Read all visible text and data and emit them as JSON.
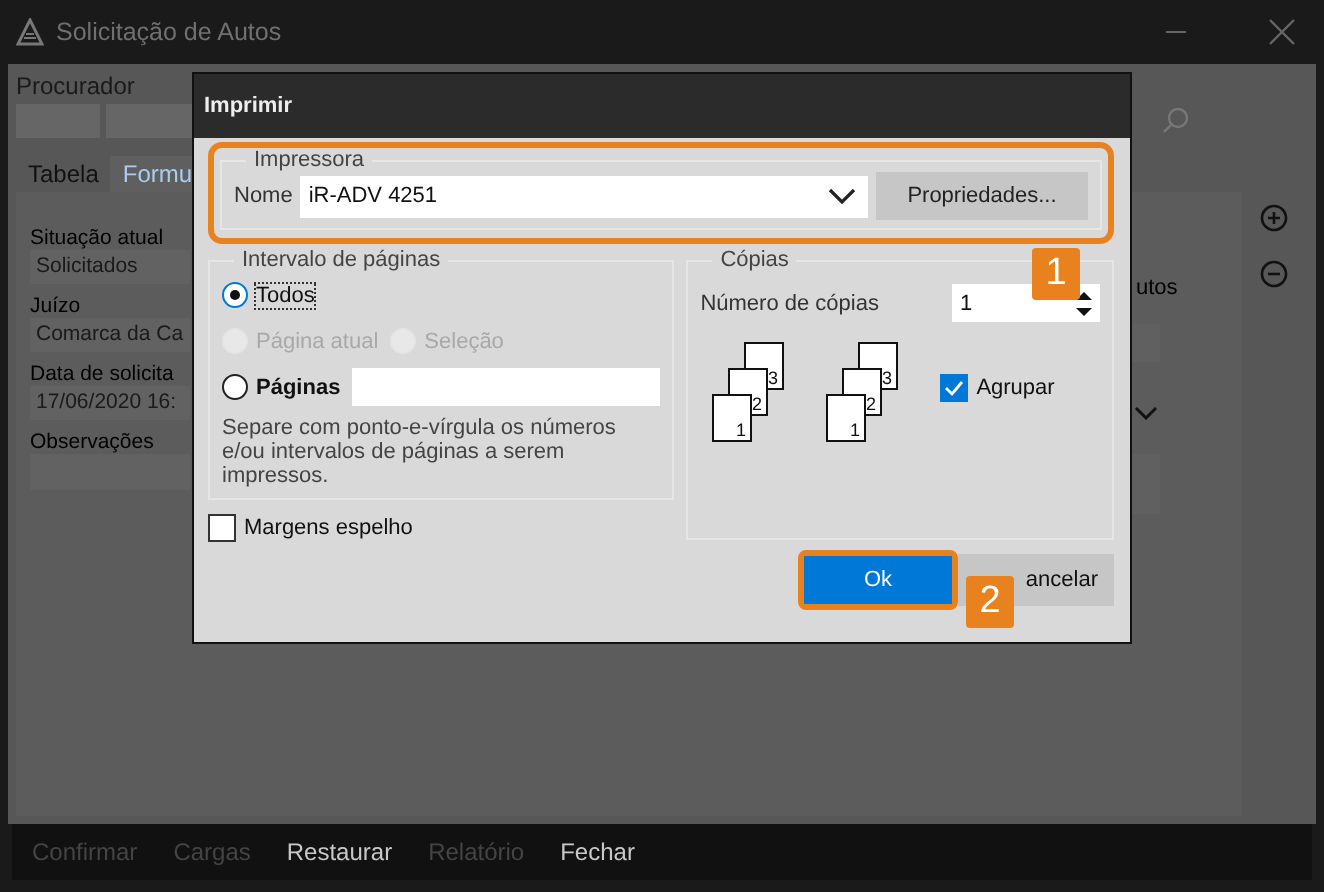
{
  "window": {
    "title": "Solicitação de Autos"
  },
  "background_form": {
    "procurador_label": "Procurador",
    "tabs": [
      {
        "label": "Tabela",
        "selected": false
      },
      {
        "label": "Formu",
        "selected": true
      }
    ],
    "fields": [
      {
        "label": "Situação atual",
        "value": "Solicitados"
      },
      {
        "label": "Juízo",
        "value": "Comarca da Ca"
      },
      {
        "label": "Data de solicita",
        "value": "17/06/2020 16:"
      },
      {
        "label": "Observações"
      }
    ],
    "side_text": "utos"
  },
  "dialog": {
    "title": "Imprimir",
    "printer": {
      "legend": "Impressora",
      "name_label": "Nome",
      "name_value": "iR-ADV 4251",
      "properties_button": "Propriedades..."
    },
    "page_range": {
      "legend": "Intervalo de páginas",
      "options": [
        {
          "label": "Todos",
          "selected": true,
          "disabled": false
        },
        {
          "label": "Página atual",
          "selected": false,
          "disabled": true
        },
        {
          "label": "Seleção",
          "selected": false,
          "disabled": true
        },
        {
          "label": "Páginas",
          "selected": false,
          "disabled": false
        }
      ],
      "pages_hint": "Separe com ponto-e-vírgula os números e/ou intervalos de páginas a serem impressos."
    },
    "copies": {
      "legend": "Cópias",
      "count_label": "Número de cópias",
      "count_value": "1",
      "stacks": [
        {
          "pages": [
            "1",
            "2",
            "3"
          ]
        },
        {
          "pages": [
            "1",
            "2",
            "3"
          ]
        }
      ],
      "collate": {
        "label": "Agrupar",
        "checked": true
      }
    },
    "mirror_margins": {
      "label": "Margens espelho",
      "checked": false
    },
    "buttons": [
      {
        "label": "Ok",
        "kind": "primary"
      },
      {
        "label": "ancelar",
        "kind": "secondary"
      }
    ]
  },
  "callouts": [
    {
      "number": "1"
    },
    {
      "number": "2"
    }
  ],
  "toolbar": [
    {
      "label": "Confirmar",
      "disabled": true
    },
    {
      "label": "Cargas",
      "disabled": true
    },
    {
      "label": "Restaurar",
      "disabled": false
    },
    {
      "label": "Relatório",
      "disabled": true
    },
    {
      "label": "Fechar",
      "disabled": false
    }
  ]
}
